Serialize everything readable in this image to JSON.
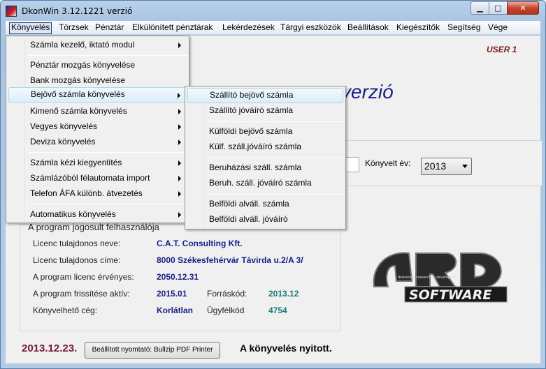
{
  "window": {
    "title": "DkonWin 3.12.1221 verzió",
    "min_glyph": "▁",
    "max_glyph": "□",
    "close_glyph": "✕"
  },
  "menubar": [
    "Könyvelés",
    "Törzsek",
    "Pénztár",
    "Elkülönített pénztárak",
    "Lekérdezések",
    "Tárgyi eszközök",
    "Beállítások",
    "Kiegészítők",
    "Segítség",
    "Vége"
  ],
  "menu_konyveles": [
    {
      "label": "Számla kezelő, iktató modul",
      "submenu": true
    },
    {
      "label": "Pénztár mozgás könyvelése",
      "submenu": false
    },
    {
      "label": "Bank mozgás könyvelése",
      "submenu": false
    },
    {
      "label": "Bejövő számla könyvelés",
      "submenu": true,
      "highlighted": true
    },
    {
      "label": "Kimenő számla könyvelés",
      "submenu": true
    },
    {
      "label": "Vegyes könyvelés",
      "submenu": true
    },
    {
      "label": "Deviza könyvelés",
      "submenu": true
    },
    {
      "label": "Számla kézi kiegyenlítés",
      "submenu": true
    },
    {
      "label": "Számlázóból félautomata import",
      "submenu": true
    },
    {
      "label": "Telefon ÁFA különb. átvezetés",
      "submenu": true
    },
    {
      "label": "Automatikus könyvelés",
      "submenu": true
    }
  ],
  "submenu_bejovo": [
    "Szállító bejövő számla",
    "Szállító jóváíró számla",
    "Külföldi bejövő számla",
    "Külf. száll.jóváíró számla",
    "Beruházási száll. számla",
    "Beruh. száll. jóváíró számla",
    "Belföldi alváll. számla",
    "Belföldi alváll. jóváíró"
  ],
  "main": {
    "user": "USER 1",
    "version_title": "verzió",
    "year_label": "Könyvelt év:",
    "year_value": "2013"
  },
  "license": {
    "title": "A program jogosult felhasználója",
    "owner_label": "Licenc tulajdonos neve:",
    "owner_value": "C.A.T. Consulting Kft.",
    "address_label": "Licenc tulajdonos címe:",
    "address_value": "8000 Székesfehérvár Távirda u.2/A 3/",
    "valid_label": "A program licenc érvényes:",
    "valid_value": "2050.12.31",
    "update_label": "A program frissítése aktív:",
    "update_value": "2015.01",
    "source_label": "Forráskód:",
    "source_value": "2013.12",
    "company_label": "Könyvelhető cég:",
    "company_value": "Korlátlan",
    "client_label": "Ügyfélkód",
    "client_value": "4754"
  },
  "logo": {
    "text": "SOFTWARE",
    "subtitle": "debreceni research & development",
    "letters": "ARD"
  },
  "status": {
    "date": "2013.12.23.",
    "printer_button": "Beállított nyomtató: Bullzip PDF Printer",
    "message": "A könyvelés nyitott."
  },
  "colors": {
    "title_blue": "#1b1f86",
    "user_red": "#7a1a1a",
    "date_red": "#7a1a3a",
    "teal": "#1d7a7a",
    "menu_highlight": "#dcedf8"
  }
}
